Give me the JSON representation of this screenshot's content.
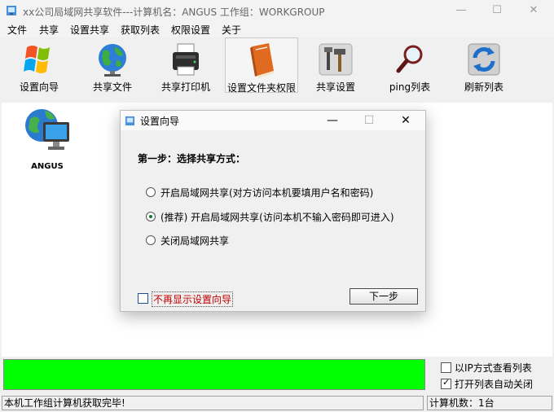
{
  "window": {
    "title": "xx公司局域网共享软件---计算机名：ANGUS  工作组：WORKGROUP"
  },
  "menu": [
    "文件",
    "共享",
    "设置共享",
    "获取列表",
    "权限设置",
    "关于"
  ],
  "toolbar": [
    {
      "label": "设置向导",
      "icon": "windows-logo-icon"
    },
    {
      "label": "共享文件",
      "icon": "globe-icon"
    },
    {
      "label": "共享打印机",
      "icon": "printer-icon"
    },
    {
      "label": "设置文件夹权限",
      "icon": "book-icon"
    },
    {
      "label": "共享设置",
      "icon": "tools-icon"
    },
    {
      "label": "ping列表",
      "icon": "magnifier-icon"
    },
    {
      "label": "刷新列表",
      "icon": "refresh-icon"
    }
  ],
  "computers": [
    {
      "name": "ANGUS"
    }
  ],
  "dialog": {
    "title": "设置向导",
    "step": "第一步：选择共享方式：",
    "options": [
      {
        "label": "开启局域网共享(对方访问本机要填用户名和密码)",
        "checked": false
      },
      {
        "label": "(推荐) 开启局域网共享(访问本机不输入密码即可进入)",
        "checked": true
      },
      {
        "label": "关闭局域网共享",
        "checked": false
      }
    ],
    "checkbox_label": "不再显示设置向导",
    "checkbox_checked": false,
    "next_button": "下一步"
  },
  "progress": {
    "percent": 100,
    "color": "#00ff00"
  },
  "options": [
    {
      "label": "以IP方式查看列表",
      "checked": false
    },
    {
      "label": "打开列表自动关闭",
      "checked": true
    }
  ],
  "status": {
    "left": "本机工作组计算机获取完毕!",
    "right": "计算机数：1台"
  }
}
